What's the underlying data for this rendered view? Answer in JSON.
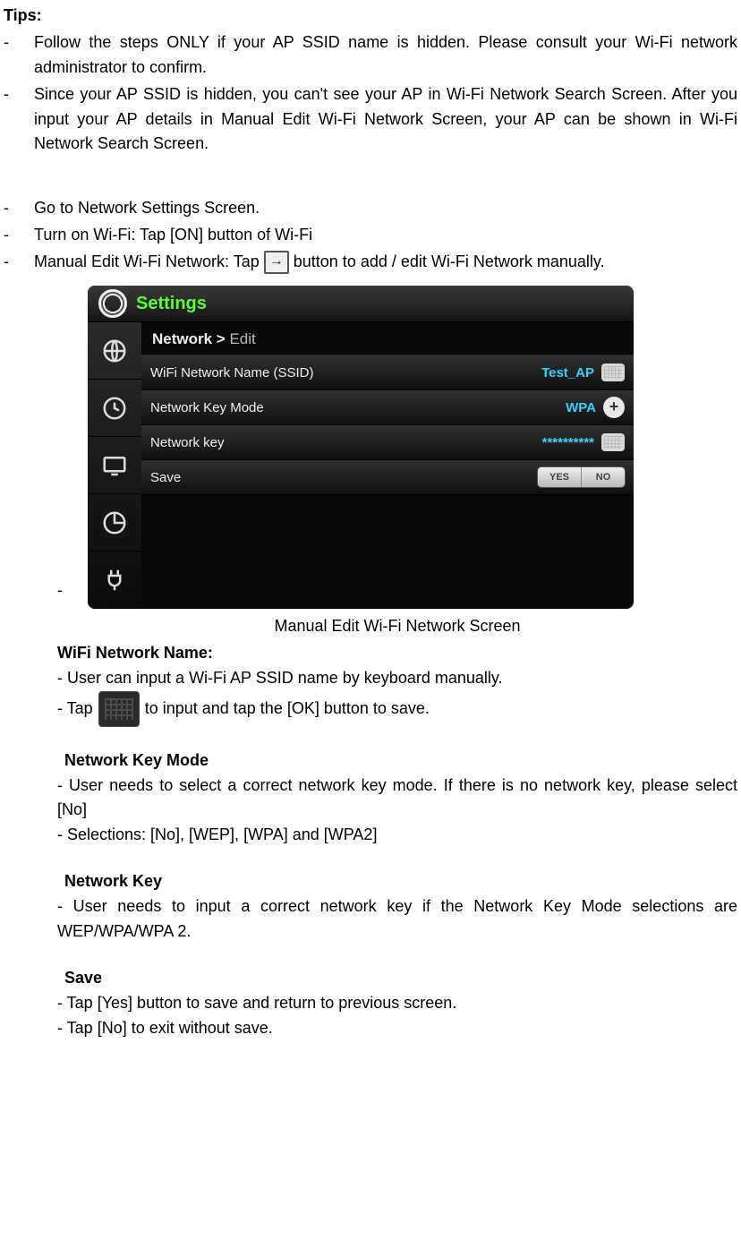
{
  "tips": {
    "heading": "Tips:",
    "items": [
      "Follow the steps ONLY if your AP SSID name is hidden. Please consult your Wi-Fi network administrator to confirm.",
      "Since your AP SSID is hidden, you can't see your AP in Wi-Fi Network Search Screen. After you input your AP details in Manual Edit Wi-Fi Network Screen, your AP can be shown in Wi-Fi Network Search Screen."
    ]
  },
  "steps": {
    "items": [
      "Go to Network Settings Screen.",
      "Turn on Wi-Fi: Tap [ON] button of Wi-Fi"
    ],
    "manual_prefix": "Manual Edit Wi-Fi Network: Tap ",
    "manual_suffix": " button to add / edit Wi-Fi Network manually."
  },
  "screenshot": {
    "title": "Settings",
    "breadcrumb_main": "Network > ",
    "breadcrumb_sub": "Edit",
    "rows": {
      "ssid_label": "WiFi Network Name (SSID)",
      "ssid_value": "Test_AP",
      "mode_label": "Network Key Mode",
      "mode_value": "WPA",
      "key_label": "Network key",
      "key_value": "**********",
      "save_label": "Save",
      "yes": "YES",
      "no": "NO"
    }
  },
  "caption": "Manual Edit Wi-Fi Network Screen",
  "wifi_name": {
    "heading": "WiFi Network Name:",
    "line1": "-   User can input a Wi-Fi AP SSID name by keyboard manually.",
    "tap_prefix": "- Tap ",
    "tap_suffix": " to input and tap the [OK] button to save."
  },
  "key_mode": {
    "heading": "Network Key Mode",
    "line1": "-   User needs to select a correct network key mode. If there is no network key, please select [No]",
    "line2": "- Selections: [No], [WEP], [WPA] and [WPA2]"
  },
  "net_key": {
    "heading": "Network Key",
    "line1": "-   User needs to input a correct network key if the Network Key Mode selections are WEP/WPA/WPA 2."
  },
  "save": {
    "heading": "Save",
    "line1": "-   Tap [Yes] button to save and return to previous screen.",
    "line2": "-   Tap [No] to exit without save."
  }
}
